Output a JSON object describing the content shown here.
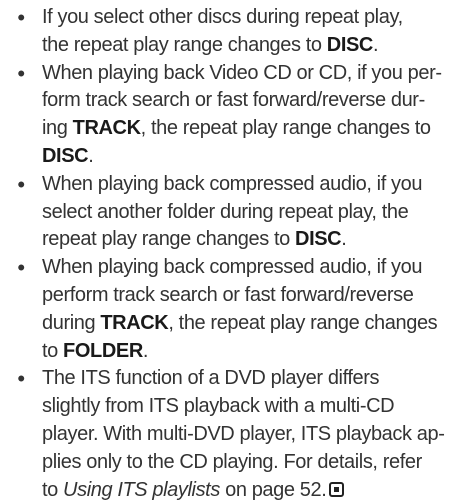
{
  "bullet_glyph": "•",
  "notes": [
    {
      "lines": [
        [
          {
            "t": "If you select other discs during repeat play,"
          }
        ],
        [
          {
            "t": "the repeat play range changes to "
          },
          {
            "t": "DISC",
            "b": true
          },
          {
            "t": "."
          }
        ]
      ]
    },
    {
      "lines": [
        [
          {
            "t": "When playing back Video CD or CD, if you per-"
          }
        ],
        [
          {
            "t": "form track search or fast forward/reverse dur-"
          }
        ],
        [
          {
            "t": "ing "
          },
          {
            "t": "TRACK",
            "b": true
          },
          {
            "t": ", the repeat play range changes to"
          }
        ],
        [
          {
            "t": "DISC",
            "b": true
          },
          {
            "t": "."
          }
        ]
      ]
    },
    {
      "lines": [
        [
          {
            "t": "When playing back compressed audio, if you"
          }
        ],
        [
          {
            "t": "select another folder during repeat play, the"
          }
        ],
        [
          {
            "t": "repeat play range changes to "
          },
          {
            "t": "DISC",
            "b": true
          },
          {
            "t": "."
          }
        ]
      ]
    },
    {
      "lines": [
        [
          {
            "t": "When playing back compressed audio, if you"
          }
        ],
        [
          {
            "t": "perform track search or fast forward/reverse"
          }
        ],
        [
          {
            "t": "during "
          },
          {
            "t": "TRACK",
            "b": true
          },
          {
            "t": ", the repeat play range changes"
          }
        ],
        [
          {
            "t": "to "
          },
          {
            "t": "FOLDER",
            "b": true
          },
          {
            "t": "."
          }
        ]
      ]
    },
    {
      "lines": [
        [
          {
            "t": "The ITS function of a DVD player differs"
          }
        ],
        [
          {
            "t": "slightly from ITS playback with a multi-CD"
          }
        ],
        [
          {
            "t": "player. With multi-DVD player, ITS playback ap-"
          }
        ],
        [
          {
            "t": "plies only to the CD playing. For details, refer"
          }
        ],
        [
          {
            "t": "to "
          },
          {
            "t": "Using ITS playlists",
            "i": true
          },
          {
            "t": " on page 52."
          }
        ]
      ],
      "end_mark": true
    }
  ]
}
